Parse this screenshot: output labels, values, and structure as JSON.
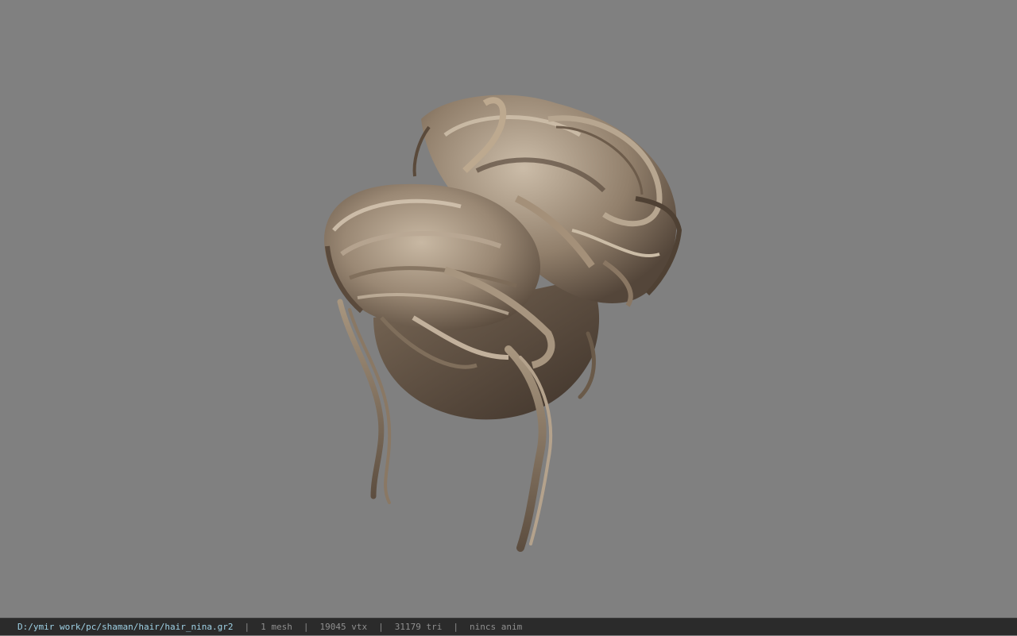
{
  "viewport": {
    "background": "#808080",
    "model_name": "hair_nina"
  },
  "status_bar": {
    "file_path": "D:/ymir work/pc/shaman/hair/hair_nina.gr2",
    "separator": "|",
    "mesh_count": "1 mesh",
    "vertex_count": "19045 vtx",
    "triangle_count": "31179 tri",
    "animation": "nincs anim"
  },
  "colors": {
    "path_text": "#9fd2e6",
    "status_text": "#8f8f8f",
    "status_background": "#2b2b2b",
    "hair_light": "#c9b9a4",
    "hair_mid": "#8c7a66",
    "hair_dark": "#4a3c30"
  }
}
